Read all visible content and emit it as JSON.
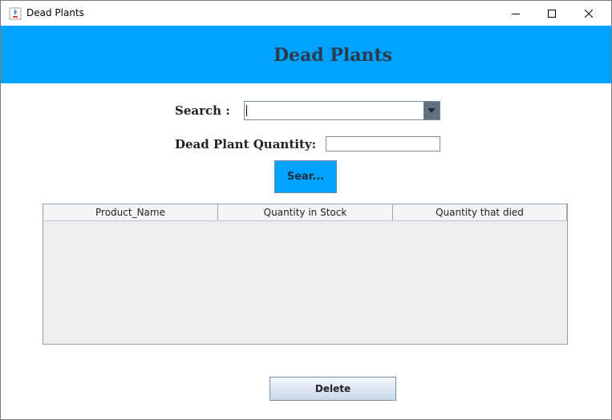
{
  "window": {
    "title": "Dead Plants",
    "icons": {
      "app": "java-app-icon",
      "minimize": "minimize-icon",
      "maximize": "maximize-icon",
      "close": "close-icon"
    }
  },
  "banner": {
    "title": "Dead Plants",
    "color": "#00a2ff"
  },
  "form": {
    "search_label": "Search :",
    "search_value": "",
    "quantity_label": "Dead Plant Quantity:",
    "quantity_value": "",
    "search_button": "Sear..."
  },
  "table": {
    "columns": [
      "Product_Name",
      "Quantity in Stock",
      "Quantity that died"
    ],
    "rows": []
  },
  "actions": {
    "delete_button": "Delete"
  }
}
